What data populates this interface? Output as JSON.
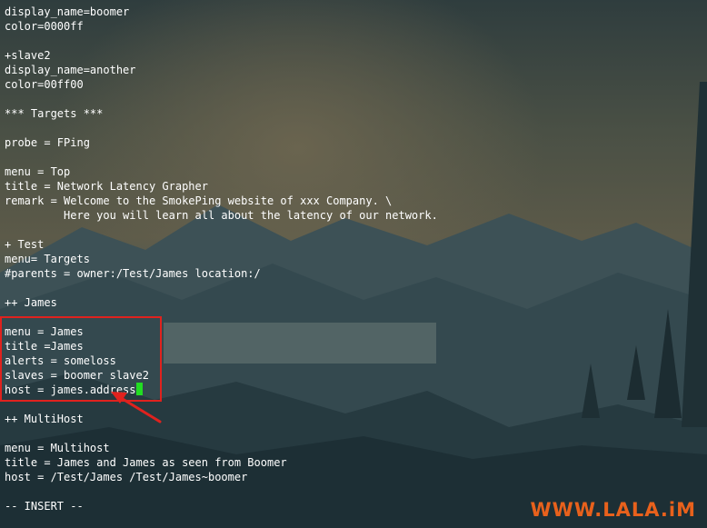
{
  "editor": {
    "lines": [
      "display_name=boomer",
      "color=0000ff",
      "",
      "+slave2",
      "display_name=another",
      "color=00ff00",
      "",
      "*** Targets ***",
      "",
      "probe = FPing",
      "",
      "menu = Top",
      "title = Network Latency Grapher",
      "remark = Welcome to the SmokePing website of xxx Company. \\",
      "         Here you will learn all about the latency of our network.",
      "",
      "+ Test",
      "menu= Targets",
      "#parents = owner:/Test/James location:/",
      "",
      "++ James",
      "",
      "menu = James",
      "title =James",
      "alerts = someloss",
      "slaves = boomer slave2",
      "host = james.address",
      "",
      "++ MultiHost",
      "",
      "menu = Multihost",
      "title = James and James as seen from Boomer",
      "host = /Test/James /Test/James~boomer",
      "",
      "-- INSERT --"
    ],
    "cursor_line": 26,
    "cursor_color": "#22dd22"
  },
  "annotation": {
    "box_color": "#e0221e",
    "arrow_color": "#e0221e"
  },
  "watermark": {
    "text": "WWW.LALA.iM",
    "color": "#e8611c"
  },
  "icons": [
    "highlight-box",
    "red-arrow-icon"
  ]
}
